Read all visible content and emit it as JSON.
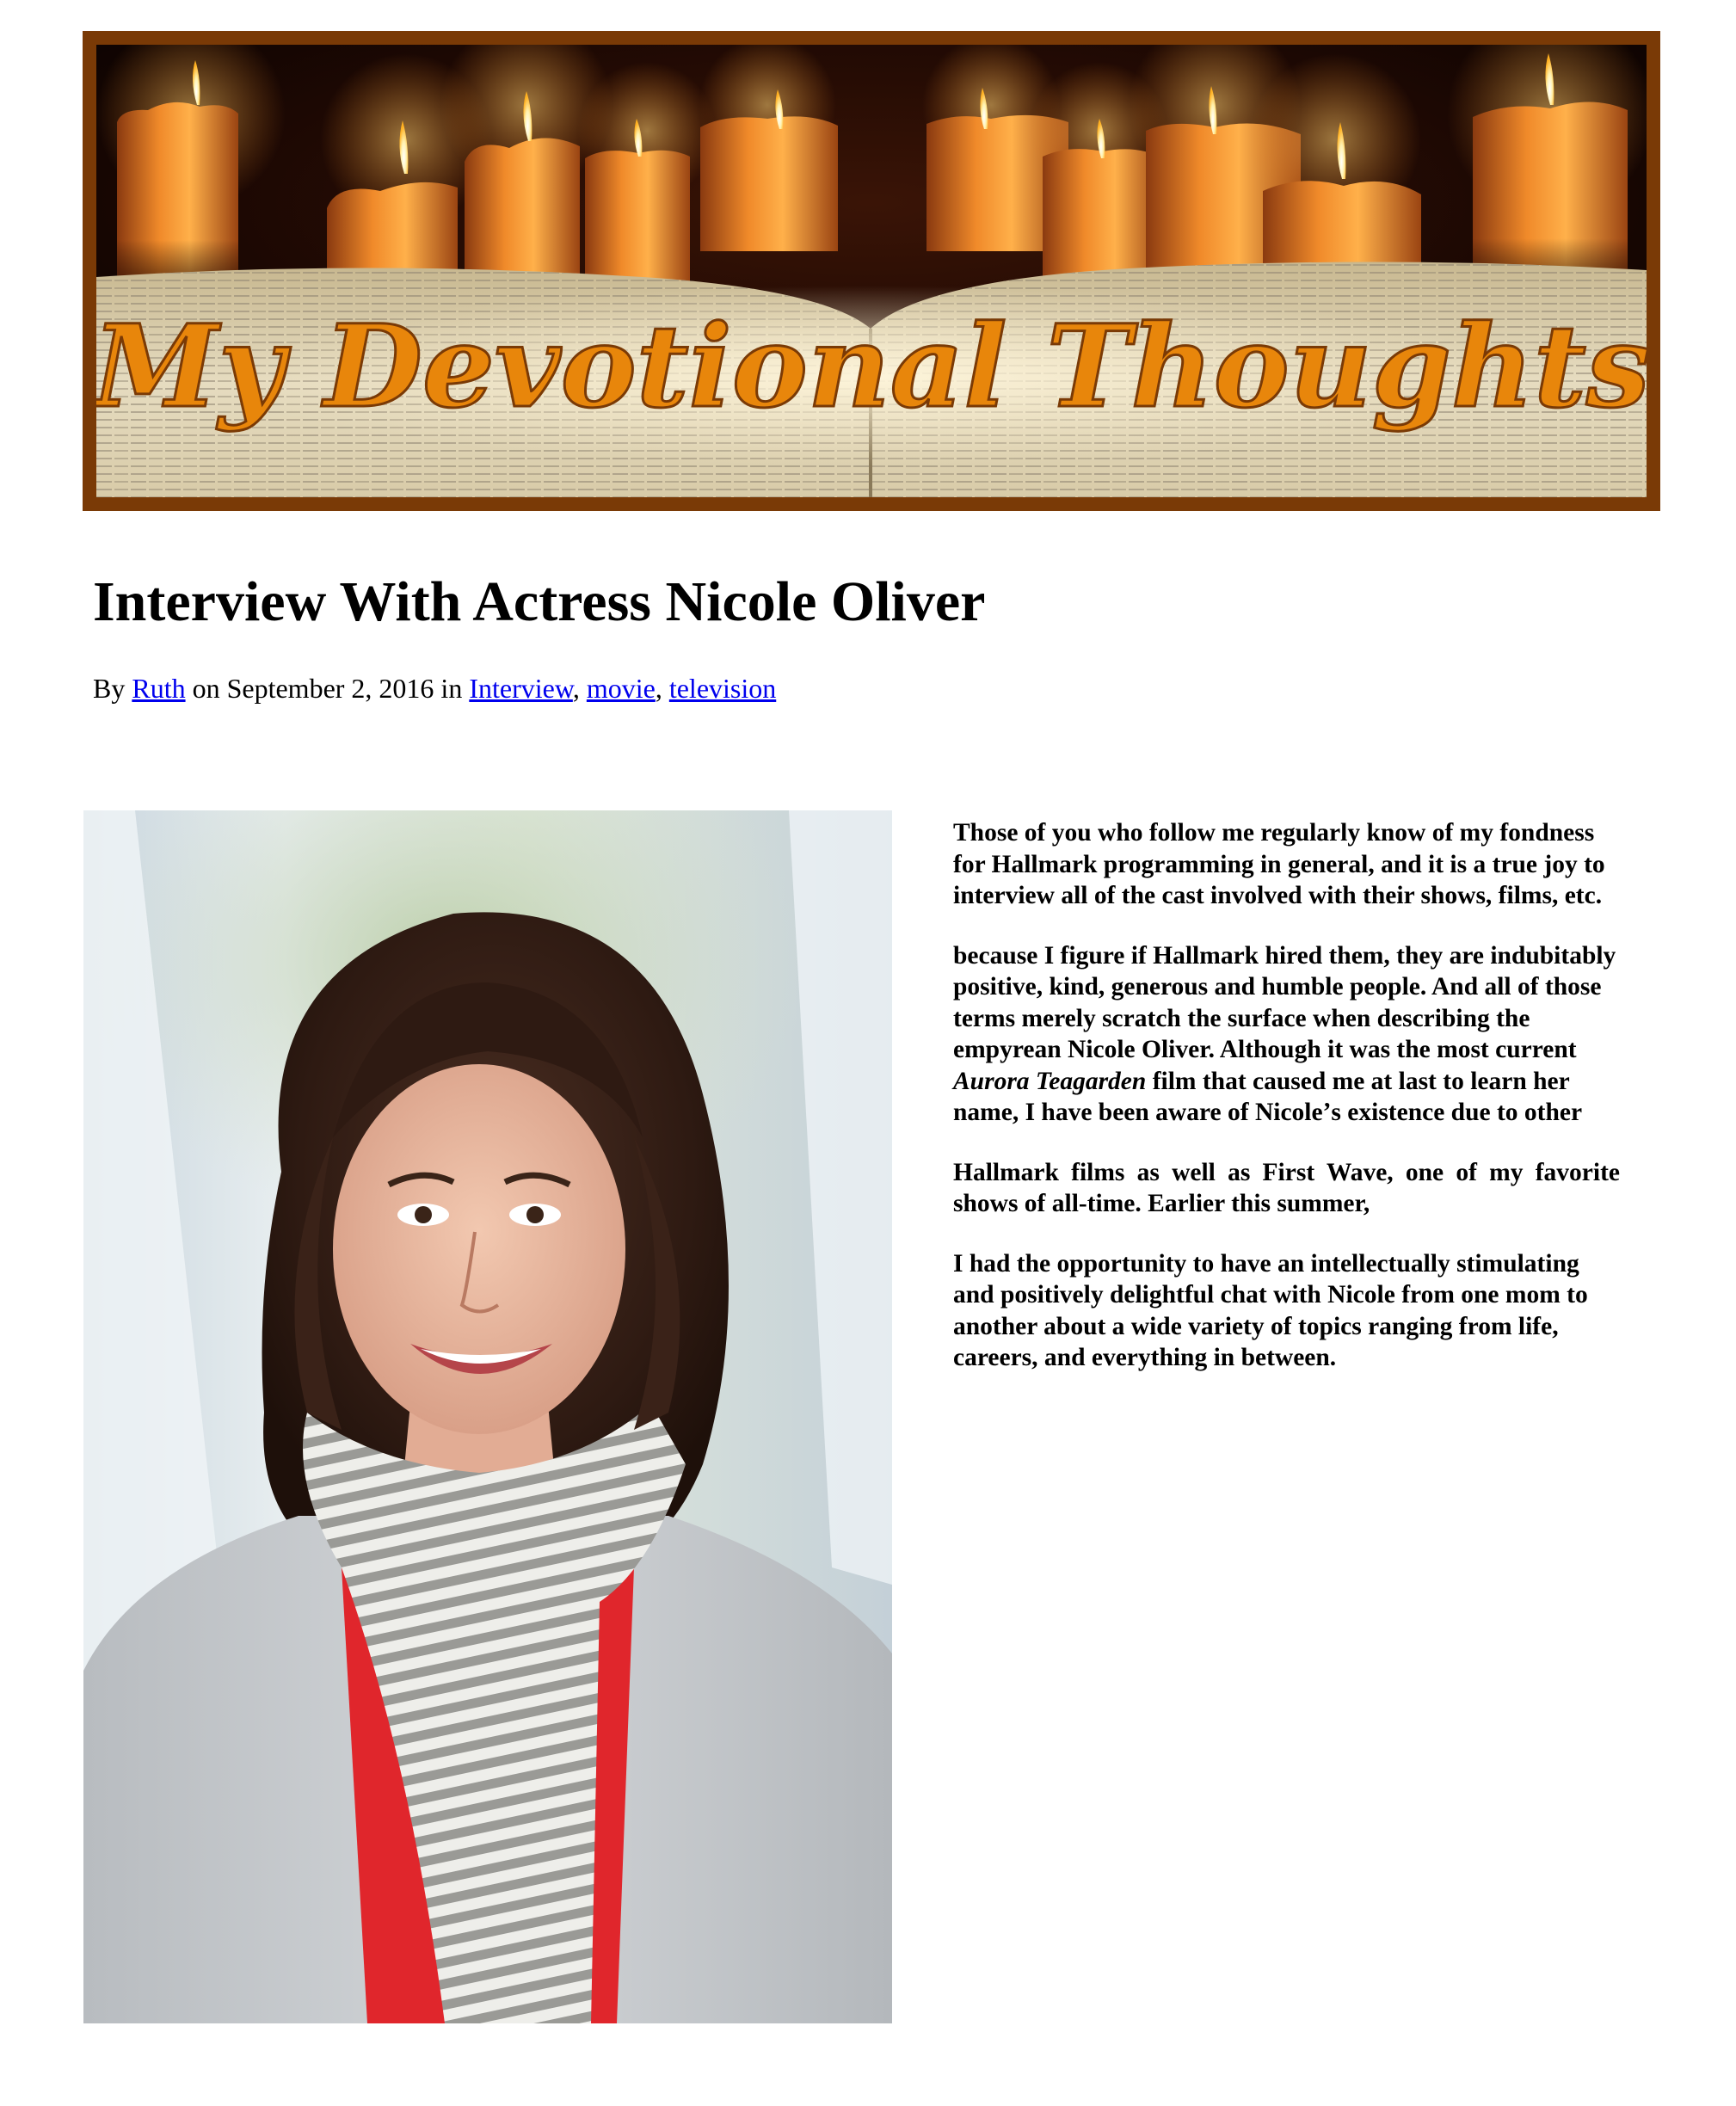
{
  "banner": {
    "logo_text": "My Devotional Thoughts",
    "colors": {
      "frame": "#7a3a06",
      "title": "#e8860b"
    }
  },
  "post": {
    "title": "Interview With Actress Nicole Oliver",
    "meta": {
      "by": "By",
      "author": "Ruth",
      "on": "on",
      "date": "September 2, 2016",
      "in": "in",
      "categories": [
        "Interview",
        "movie",
        "television"
      ],
      "sep": ","
    },
    "photo": {
      "icon": "portrait-photo",
      "alt": "Nicole Oliver"
    },
    "paragraphs": {
      "p1": "Those of you who follow me regularly know of my fondness for Hallmark programming in general, and it is a true joy to interview all of the cast involved with their shows, films, etc.",
      "p2_before": "because I figure if Hallmark hired them, they are indubitably positive, kind, generous and humble people. And all of those terms merely scratch the surface when describing the empyrean Nicole Oliver. Although it was the most current ",
      "p2_italic": "Aurora Teagarden",
      "p2_after": " film that caused me at last to learn her name, I have been aware of Nicoleʼs existence due to other",
      "p3": "Hallmark films as well as First Wave, one of my favorite shows of all-time. Earlier this summer,",
      "p4": "I had the opportunity to have an intellectually stimulating and positively delightful chat with Nicole from one mom to another about a wide variety of topics ranging from life, careers, and everything in between."
    }
  }
}
